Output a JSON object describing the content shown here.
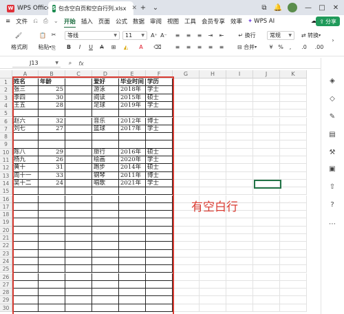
{
  "tabs": {
    "app": "WPS Office",
    "file": "包含空白页和空白行列.xlsx",
    "new_tab": "+",
    "dropdown": "⌄"
  },
  "menubar": {
    "file": "文件",
    "items": [
      "开始",
      "插入",
      "页面",
      "公式",
      "数据",
      "审阅",
      "视图",
      "工具",
      "会员专享",
      "效率"
    ],
    "wps_ai": "WPS AI",
    "share": "分享"
  },
  "toolbar": {
    "format_painter": "格式刷",
    "paste": "粘贴",
    "font_name": "等线",
    "font_size": "11",
    "wrap": "换行",
    "merge": "合并",
    "number_format": "常规",
    "convert": "转换"
  },
  "formula_bar": {
    "cell_ref": "J13",
    "fx": "fx"
  },
  "columns": [
    "A",
    "B",
    "C",
    "D",
    "E",
    "F",
    "G",
    "H",
    "I",
    "J",
    "K"
  ],
  "rows": [
    "1",
    "2",
    "3",
    "4",
    "5",
    "6",
    "7",
    "8",
    "9",
    "10",
    "11",
    "12",
    "13",
    "14",
    "15",
    "16",
    "17",
    "18",
    "19",
    "20",
    "21",
    "22",
    "23",
    "24",
    "25",
    "26",
    "27",
    "28",
    "29",
    "30"
  ],
  "table": {
    "headers": [
      "姓名",
      "年龄",
      "",
      "爱好",
      "毕业时间",
      "学历"
    ],
    "rows": [
      [
        "张三",
        "25",
        "",
        "游泳",
        "2018年",
        "学士"
      ],
      [
        "李四",
        "30",
        "",
        "阅读",
        "2015年",
        "硕士"
      ],
      [
        "王五",
        "28",
        "",
        "足球",
        "2019年",
        "学士"
      ],
      [
        "",
        "",
        "",
        "",
        "",
        ""
      ],
      [
        "赵六",
        "32",
        "",
        "音乐",
        "2012年",
        "博士"
      ],
      [
        "刘七",
        "27",
        "",
        "篮球",
        "2017年",
        "学士"
      ],
      [
        "",
        "",
        "",
        "",
        "",
        ""
      ],
      [
        "",
        "",
        "",
        "",
        "",
        ""
      ],
      [
        "陈八",
        "29",
        "",
        "旅行",
        "2016年",
        "硕士"
      ],
      [
        "杨九",
        "26",
        "",
        "绘画",
        "2020年",
        "学士"
      ],
      [
        "黄十",
        "31",
        "",
        "跑步",
        "2014年",
        "硕士"
      ],
      [
        "周十一",
        "33",
        "",
        "钢琴",
        "2011年",
        "博士"
      ],
      [
        "吴十二",
        "24",
        "",
        "唱歌",
        "2021年",
        "学士"
      ]
    ]
  },
  "annotation": "有空白行",
  "colors": {
    "accent": "#1a6b3d",
    "highlight": "#d93a30",
    "selection": "#217346"
  }
}
